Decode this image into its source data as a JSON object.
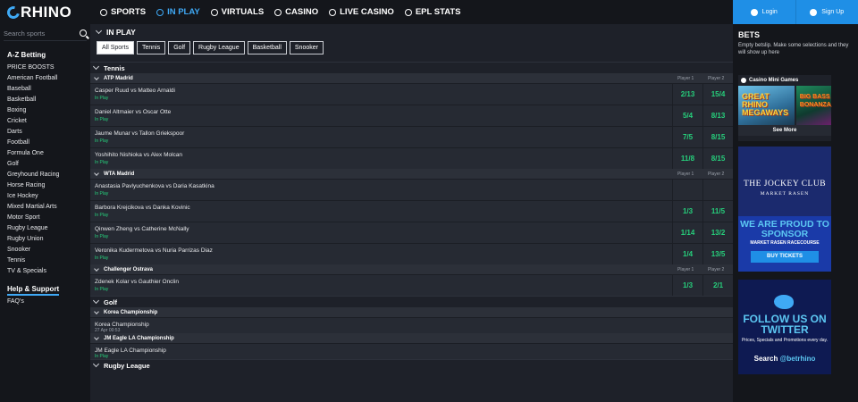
{
  "brand": "RHINO",
  "nav": [
    {
      "label": "SPORTS",
      "icon": "soccer-ball-icon",
      "active": false
    },
    {
      "label": "IN PLAY",
      "icon": "stopwatch-icon",
      "active": true
    },
    {
      "label": "VIRTUALS",
      "icon": "virtuals-icon",
      "active": false
    },
    {
      "label": "CASINO",
      "icon": "casino-chip-icon",
      "active": false
    },
    {
      "label": "LIVE CASINO",
      "icon": "live-casino-icon",
      "active": false
    },
    {
      "label": "EPL STATS",
      "icon": "stats-icon",
      "active": false
    }
  ],
  "auth": {
    "login": "Login",
    "signup": "Sign Up"
  },
  "sidebar": {
    "search_placeholder": "Search sports",
    "az_title": "A-Z Betting",
    "items": [
      "PRICE BOOSTS",
      "American Football",
      "Baseball",
      "Basketball",
      "Boxing",
      "Cricket",
      "Darts",
      "Football",
      "Formula One",
      "Golf",
      "Greyhound Racing",
      "Horse Racing",
      "Ice Hockey",
      "Mixed Martial Arts",
      "Motor Sport",
      "Rugby League",
      "Rugby Union",
      "Snooker",
      "Tennis",
      "TV & Specials"
    ],
    "help_title": "Help & Support",
    "help_items": [
      "FAQ's"
    ]
  },
  "main": {
    "title": "IN PLAY",
    "filters": [
      {
        "label": "All Sports",
        "active": true
      },
      {
        "label": "Tennis",
        "active": false
      },
      {
        "label": "Golf",
        "active": false
      },
      {
        "label": "Rugby League",
        "active": false
      },
      {
        "label": "Basketball",
        "active": false
      },
      {
        "label": "Snooker",
        "active": false
      }
    ],
    "player1_label": "Player 1",
    "player2_label": "Player 2",
    "sports": [
      {
        "name": "Tennis",
        "competitions": [
          {
            "name": "ATP Madrid",
            "show_players": true,
            "events": [
              {
                "name": "Casper Ruud vs Matteo Arnaldi",
                "status": "In Play",
                "odds": [
                  "2/13",
                  "15/4"
                ]
              },
              {
                "name": "Daniel Altmaier vs Oscar Otte",
                "status": "In Play",
                "odds": [
                  "5/4",
                  "8/13"
                ]
              },
              {
                "name": "Jaume Munar vs Tallon Griekspoor",
                "status": "In Play",
                "odds": [
                  "7/5",
                  "8/15"
                ]
              },
              {
                "name": "Yoshihito Nishioka vs Alex Molcan",
                "status": "In Play",
                "odds": [
                  "11/8",
                  "8/15"
                ]
              }
            ]
          },
          {
            "name": "WTA Madrid",
            "show_players": true,
            "events": [
              {
                "name": "Anastasia Pavlyuchenkova vs Daria Kasatkina",
                "status": "In Play",
                "odds": [
                  "",
                  ""
                ]
              },
              {
                "name": "Barbora Krejcikova vs Danka Kovinic",
                "status": "In Play",
                "odds": [
                  "1/3",
                  "11/5"
                ]
              },
              {
                "name": "Qinwen Zheng vs Catherine McNally",
                "status": "In Play",
                "odds": [
                  "1/14",
                  "13/2"
                ]
              },
              {
                "name": "Veronika Kudermetova vs Nuria Parrizas Diaz",
                "status": "In Play",
                "odds": [
                  "1/4",
                  "13/5"
                ]
              }
            ]
          },
          {
            "name": "Challenger Ostrava",
            "show_players": true,
            "events": [
              {
                "name": "Zdenek Kolar vs Gauthier Onclin",
                "status": "In Play",
                "odds": [
                  "1/3",
                  "2/1"
                ]
              }
            ]
          }
        ]
      },
      {
        "name": "Golf",
        "competitions": [
          {
            "name": "Korea Championship",
            "show_players": false,
            "events": [
              {
                "name": "Korea Championship",
                "status": "27 Apr 00:53",
                "odds": []
              }
            ]
          },
          {
            "name": "JM Eagle LA Championship",
            "show_players": false,
            "events": [
              {
                "name": "JM Eagle LA Championship",
                "status": "In Play",
                "odds": []
              }
            ]
          }
        ]
      },
      {
        "name": "Rugby League",
        "competitions": []
      }
    ]
  },
  "betslip": {
    "title": "BETS",
    "empty": "Empty betslip. Make some selections and they will show up here",
    "mini_games_title": "Casino Mini Games",
    "game1": "GREAT RHINO MEGAWAYS",
    "game2": "BIG BASS BONANZA",
    "see_more": "See More",
    "ad1": {
      "title": "THE JOCKEY CLUB",
      "subtitle": "MARKET RASEN",
      "headline": "WE ARE PROUD TO SPONSOR",
      "venue": "MARKET RASEN  RACECOURSE",
      "button": "BUY TICKETS"
    },
    "ad2": {
      "headline": "FOLLOW US ON TWITTER",
      "sub": "Prices, Specials and Promotions every day.",
      "search": "Search",
      "handle": "@betrhino"
    }
  },
  "colors": {
    "accent": "#3fa9f5",
    "odds_green": "#26d07c",
    "auth_blue": "#1f8fe6",
    "background": "#1e2129"
  }
}
